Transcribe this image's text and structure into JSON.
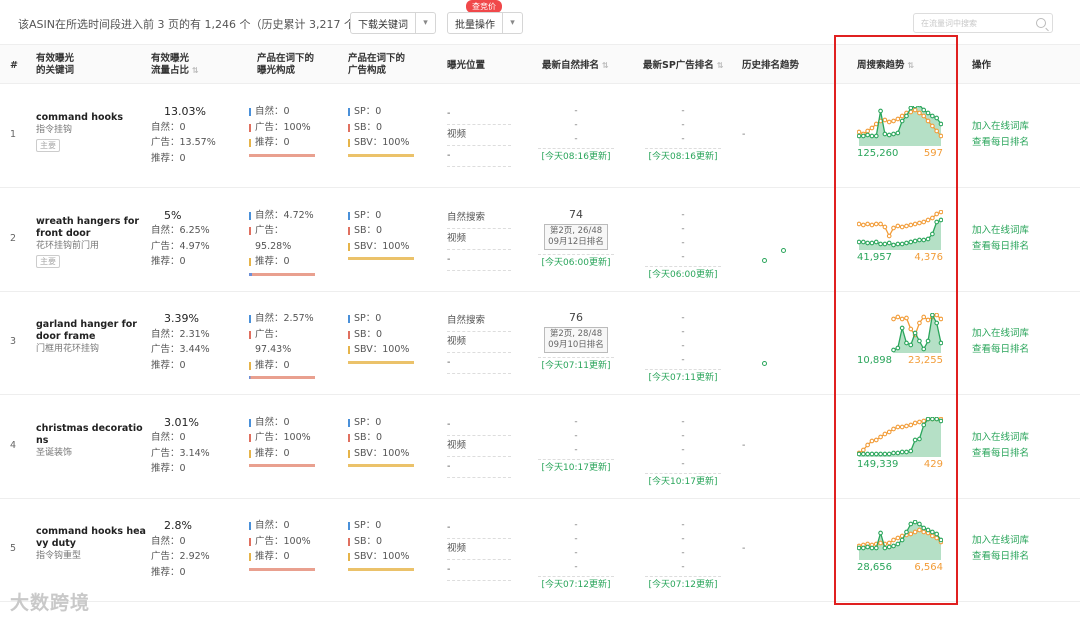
{
  "header": {
    "summary": "该ASIN在所选时间段进入前 3 页的有 1,246 个（历史累计 3,217 个）",
    "download_label": "下载关键词",
    "batch_label": "批量操作",
    "badge": "查竞价",
    "search_placeholder": "在流量词中搜索"
  },
  "columns": {
    "num": "#",
    "keyword": [
      "有效曝光",
      "的关键词"
    ],
    "share": [
      "有效曝光",
      "流量占比"
    ],
    "exposure": [
      "产品在词下的",
      "曝光构成"
    ],
    "ad": [
      "产品在词下的",
      "广告构成"
    ],
    "position": "曝光位置",
    "natural_rank": "最新自然排名",
    "sp_rank": "最新SP广告排名",
    "history": "历史排名趋势",
    "weekly": "周搜索趋势",
    "ops": "操作"
  },
  "colors": {
    "green": "#2aa55b",
    "orange": "#f29c38",
    "accent_red": "#e02020"
  },
  "rows": [
    {
      "idx": "1",
      "en": "command hooks",
      "cn": "指令挂钩",
      "tag": "主要",
      "share": "13.03%",
      "s_nat": "自然：0",
      "s_ad": "广告：13.57%",
      "s_rec": "推荐：0",
      "e_nat": "自然：0",
      "e_ad": "广告：100%",
      "e_rec": "推荐：0",
      "a_sp": "SP：0",
      "a_sb": "SB：0",
      "a_sbv": "SBV：100%",
      "pos": [
        "-",
        "视频",
        "-"
      ],
      "nat_rank": [
        "-",
        "-",
        "-"
      ],
      "nat_box": "",
      "nat_upd": "[今天08:16更新]",
      "sp_rank": [
        "-",
        "-",
        "-"
      ],
      "sp_upd": "[今天08:16更新]",
      "hist": "-",
      "w_green": "125,260",
      "w_orange": "597",
      "sg": [
        10,
        10,
        11,
        10,
        10,
        35,
        12,
        11,
        12,
        13,
        25,
        30,
        38,
        40,
        41,
        36,
        33,
        30,
        28,
        22
      ],
      "so": [
        14,
        12,
        15,
        18,
        22,
        25,
        26,
        24,
        25,
        27,
        30,
        33,
        34,
        36,
        33,
        30,
        25,
        20,
        15,
        10
      ],
      "op1": "加入在线词库",
      "op2": "查看每日排名"
    },
    {
      "idx": "2",
      "en": "wreath hangers for front door",
      "cn": "花环挂钩前门用",
      "tag": "主要",
      "share": "5%",
      "s_nat": "自然：6.25%",
      "s_ad": "广告：4.97%",
      "s_rec": "推荐：0",
      "e_nat": "自然：4.72%",
      "e_ad": "广告：95.28%",
      "e_rec": "推荐：0",
      "a_sp": "SP：0",
      "a_sb": "SB：0",
      "a_sbv": "SBV：100%",
      "pos": [
        "自然搜索",
        "视频",
        "-"
      ],
      "nat_rank": [
        "74"
      ],
      "nat_box": "第2页, 26/48\n09月12日排名",
      "nat_upd": "[今天06:00更新]",
      "sp_rank": [
        "-",
        "-",
        "-",
        "-"
      ],
      "sp_upd": "[今天06:00更新]",
      "hist": "",
      "w_green": "41,957",
      "w_orange": "4,376",
      "sg": [
        8,
        8,
        7,
        7,
        8,
        6,
        6,
        7,
        5,
        6,
        6,
        7,
        8,
        9,
        10,
        10,
        11,
        16,
        28,
        30
      ],
      "so": [
        26,
        25,
        26,
        25,
        26,
        26,
        23,
        14,
        22,
        24,
        23,
        24,
        25,
        26,
        27,
        28,
        30,
        32,
        36,
        38
      ],
      "op1": "加入在线词库",
      "op2": "查看每日排名"
    },
    {
      "idx": "3",
      "en": "garland hanger for door frame",
      "cn": "门框用花环挂钩",
      "tag": "",
      "share": "3.39%",
      "s_nat": "自然：2.31%",
      "s_ad": "广告：3.44%",
      "s_rec": "推荐：0",
      "e_nat": "自然：2.57%",
      "e_ad": "广告：97.43%",
      "e_rec": "推荐：0",
      "a_sp": "SP：0",
      "a_sb": "SB：0",
      "a_sbv": "SBV：100%",
      "pos": [
        "自然搜索",
        "视频",
        "-"
      ],
      "nat_rank": [
        "76"
      ],
      "nat_box": "第2页, 28/48\n09月10日排名",
      "nat_upd": "[今天07:11更新]",
      "sp_rank": [
        "-",
        "-",
        "-",
        "-"
      ],
      "sp_upd": "[今天07:11更新]",
      "hist": "",
      "w_green": "10,898",
      "w_orange": "23,255",
      "sg": [
        0,
        0,
        0,
        0,
        0,
        0,
        0,
        0,
        3,
        5,
        25,
        10,
        8,
        20,
        12,
        4,
        12,
        38,
        30,
        10
      ],
      "so": [
        0,
        0,
        0,
        0,
        0,
        0,
        0,
        0,
        34,
        36,
        34,
        35,
        24,
        18,
        30,
        36,
        33,
        36,
        38,
        34
      ],
      "op1": "加入在线词库",
      "op2": "查看每日排名"
    },
    {
      "idx": "4",
      "en": "christmas decorations",
      "cn": "圣诞装饰",
      "tag": "",
      "share": "3.01%",
      "s_nat": "自然：0",
      "s_ad": "广告：3.14%",
      "s_rec": "推荐：0",
      "e_nat": "自然：0",
      "e_ad": "广告：100%",
      "e_rec": "推荐：0",
      "a_sp": "SP：0",
      "a_sb": "SB：0",
      "a_sbv": "SBV：100%",
      "pos": [
        "-",
        "视频",
        "-"
      ],
      "nat_rank": [
        "-",
        "-",
        "-"
      ],
      "nat_box": "",
      "nat_upd": "[今天10:17更新]",
      "sp_rank": [
        "-",
        "-",
        "-",
        "-"
      ],
      "sp_upd": "[今天10:17更新]",
      "hist": "-",
      "w_green": "149,339",
      "w_orange": "429",
      "sg": [
        3,
        3,
        3,
        3,
        3,
        3,
        3,
        3,
        4,
        4,
        5,
        5,
        6,
        17,
        18,
        32,
        38,
        38,
        38,
        36
      ],
      "so": [
        4,
        7,
        12,
        16,
        17,
        20,
        23,
        25,
        28,
        30,
        30,
        31,
        32,
        34,
        35,
        36,
        38,
        38,
        38,
        38
      ],
      "op1": "加入在线词库",
      "op2": "查看每日排名"
    },
    {
      "idx": "5",
      "en": "command hooks heavy duty",
      "cn": "指令钩重型",
      "tag": "",
      "share": "2.8%",
      "s_nat": "自然：0",
      "s_ad": "广告：2.92%",
      "s_rec": "推荐：0",
      "e_nat": "自然：0",
      "e_ad": "广告：100%",
      "e_rec": "推荐：0",
      "a_sp": "SP：0",
      "a_sb": "SB：0",
      "a_sbv": "SBV：100%",
      "pos": [
        "-",
        "视频",
        "-"
      ],
      "nat_rank": [
        "-",
        "-",
        "-",
        "-"
      ],
      "nat_box": "",
      "nat_upd": "[今天07:12更新]",
      "sp_rank": [
        "-",
        "-",
        "-",
        "-"
      ],
      "sp_upd": "[今天07:12更新]",
      "hist": "-",
      "w_green": "28,656",
      "w_orange": "6,564",
      "sg": [
        12,
        12,
        13,
        12,
        12,
        27,
        12,
        13,
        14,
        16,
        20,
        28,
        36,
        38,
        36,
        32,
        30,
        28,
        26,
        20
      ],
      "so": [
        14,
        15,
        16,
        15,
        16,
        17,
        16,
        17,
        20,
        22,
        24,
        25,
        26,
        28,
        30,
        28,
        27,
        24,
        22,
        18
      ],
      "op1": "加入在线词库",
      "op2": "查看每日排名"
    }
  ],
  "watermark": "大数跨境"
}
